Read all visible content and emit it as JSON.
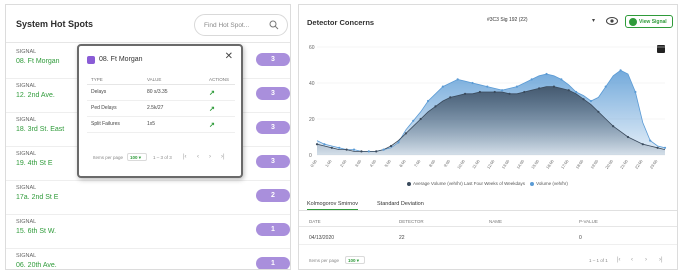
{
  "left_panel": {
    "title": "System Hot Spots",
    "search_placeholder": "Find Hot Spot...",
    "spots": [
      {
        "label": "SIGNAL",
        "name": "08. Ft Morgan",
        "count": "3"
      },
      {
        "label": "SIGNAL",
        "name": "12. 2nd Ave.",
        "count": "3"
      },
      {
        "label": "SIGNAL",
        "name": "18. 3rd St. East",
        "count": "3"
      },
      {
        "label": "SIGNAL",
        "name": "19. 4th St E",
        "count": "3"
      },
      {
        "label": "SIGNAL",
        "name": "17a. 2nd St E",
        "count": "2"
      },
      {
        "label": "SIGNAL",
        "name": "15. 6th St W.",
        "count": "1"
      },
      {
        "label": "SIGNAL",
        "name": "06. 20th Ave.",
        "count": "1"
      }
    ]
  },
  "popup": {
    "title": "08. Ft Morgan",
    "close": "✕",
    "columns": [
      "TYPE",
      "VALUE",
      "ACTIONS"
    ],
    "rows": [
      {
        "type": "Delays",
        "value": "80 s/3.35",
        "action": "↗"
      },
      {
        "type": "Ped Delays",
        "value": "2.5k/27",
        "action": "↗"
      },
      {
        "type": "Split Failures",
        "value": "1x5",
        "action": "↗"
      }
    ],
    "pager": {
      "label": "Items per page",
      "size": "100 ▾",
      "range": "1 – 3 of 3",
      "first": "|‹",
      "prev": "‹",
      "next": "›",
      "last": "›|"
    }
  },
  "right_panel": {
    "title": "Detector Concerns",
    "select_value": "#3C3 Sig 192 (22)",
    "select_arrow": "▾",
    "view_signal": "View Signal",
    "tabs": [
      "Kolmogorov Smirnov",
      "Standard Deviation"
    ],
    "table_columns": [
      "DATE",
      "DETECTOR",
      "NAME",
      "P-VALUE"
    ],
    "table_rows": [
      {
        "date": "04/13/2020",
        "detector": "22",
        "name": "",
        "pvalue": "0"
      }
    ],
    "pager": {
      "label": "Items per page",
      "size": "100 ▾",
      "range": "1 – 1 of 1",
      "first": "|‹",
      "prev": "‹",
      "next": "›",
      "last": "›|"
    }
  },
  "chart_data": {
    "type": "area",
    "ylim": [
      0,
      60
    ],
    "yticks": [
      "60",
      "40",
      "20",
      "0"
    ],
    "x": [
      "0:00",
      "0:30",
      "1:00",
      "1:30",
      "2:00",
      "2:30",
      "3:00",
      "3:30",
      "4:00",
      "4:30",
      "5:00",
      "5:30",
      "6:00",
      "6:30",
      "7:00",
      "7:30",
      "8:00",
      "8:30",
      "9:00",
      "9:30",
      "10:00",
      "10:30",
      "11:00",
      "11:30",
      "12:00",
      "12:30",
      "13:00",
      "13:30",
      "14:00",
      "14:30",
      "15:00",
      "15:30",
      "16:00",
      "16:30",
      "17:00",
      "17:30",
      "18:00",
      "18:30",
      "19:00",
      "19:30",
      "20:00",
      "20:30",
      "21:00",
      "21:30",
      "22:00",
      "22:30",
      "23:00",
      "23:30"
    ],
    "series": [
      {
        "name": "Average Volume (veh/hr) Last Four Weeks of Weekdays",
        "color": "#3a4a5c",
        "values": [
          6,
          5,
          4,
          3,
          3,
          2,
          2,
          2,
          2,
          3,
          5,
          8,
          12,
          16,
          20,
          24,
          27,
          30,
          32,
          33,
          34,
          34,
          35,
          35,
          35,
          35,
          34,
          34,
          35,
          36,
          37,
          38,
          38,
          37,
          36,
          34,
          31,
          28,
          24,
          20,
          16,
          13,
          10,
          8,
          6,
          5,
          4,
          3
        ]
      },
      {
        "name": "Volume (veh/hr)",
        "color": "#5b9bd5",
        "values": [
          8,
          6,
          5,
          4,
          3,
          3,
          2,
          2,
          2,
          3,
          4,
          7,
          14,
          19,
          24,
          30,
          34,
          38,
          40,
          42,
          41,
          40,
          39,
          38,
          37,
          36,
          37,
          38,
          40,
          42,
          44,
          45,
          44,
          42,
          39,
          35,
          33,
          30,
          32,
          38,
          44,
          47,
          45,
          35,
          18,
          8,
          5,
          4
        ]
      }
    ]
  },
  "colors": {
    "accent": "#2f9b3a",
    "pill": "#a98fdc",
    "series_dark": "#3a4a5c",
    "series_blue": "#5b9bd5"
  },
  "icons": {
    "search": "search-icon",
    "popup": "signal-icon",
    "eye": "eye-icon",
    "view": "view-signal-icon",
    "expand": "expand-icon",
    "trend": "trend-icon"
  }
}
